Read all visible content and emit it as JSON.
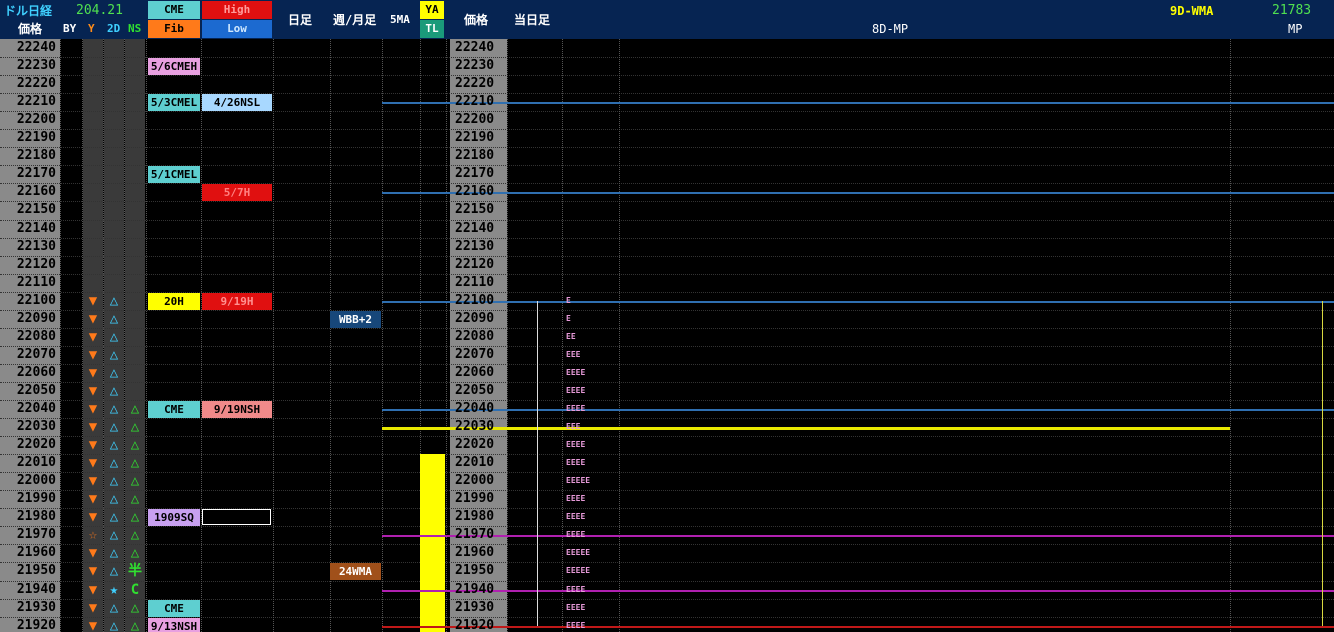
{
  "header": {
    "instrument": "ドル日経",
    "fx_value": "204.21",
    "price_label": "価格",
    "by": "BY",
    "y": "Y",
    "two_d": "2D",
    "ns": "NS",
    "cme": "CME",
    "fib": "Fib",
    "high": "High",
    "low": "Low",
    "daily": "日足",
    "weekly_monthly": "週/月足",
    "five_ma": "5MA",
    "ya": "YA",
    "tl": "TL",
    "price_label2": "価格",
    "today": "当日足",
    "wma_label": "9D-WMA",
    "wma_value": "21783",
    "mp8d": "8D-MP",
    "mp": "MP"
  },
  "prices": [
    "22240",
    "22230",
    "22220",
    "22210",
    "22200",
    "22190",
    "22180",
    "22170",
    "22160",
    "22150",
    "22140",
    "22130",
    "22120",
    "22110",
    "22100",
    "22090",
    "22080",
    "22070",
    "22060",
    "22050",
    "22040",
    "22030",
    "22020",
    "22010",
    "22000",
    "21990",
    "21980",
    "21970",
    "21960",
    "21950",
    "21940",
    "21930",
    "21920"
  ],
  "by_symbols": [
    "",
    "",
    "",
    "",
    "",
    "",
    "",
    "",
    "",
    "",
    "",
    "",
    "",
    "",
    "▼",
    "▼",
    "▼",
    "▼",
    "▼",
    "▼",
    "▼",
    "▼",
    "▼",
    "▼",
    "▼",
    "▼",
    "▼",
    "☆",
    "▼",
    "▼",
    "▼",
    "▼",
    "▼"
  ],
  "twod_symbols": [
    "",
    "",
    "",
    "",
    "",
    "",
    "",
    "",
    "",
    "",
    "",
    "",
    "",
    "",
    "△",
    "△",
    "△",
    "△",
    "△",
    "△",
    "△",
    "△",
    "△",
    "△",
    "△",
    "△",
    "△",
    "△",
    "△",
    "△",
    "★",
    "△",
    "△"
  ],
  "ns_symbols": [
    "",
    "",
    "",
    "",
    "",
    "",
    "",
    "",
    "",
    "",
    "",
    "",
    "",
    "",
    "",
    "",
    "",
    "",
    "",
    "",
    "△",
    "△",
    "△",
    "△",
    "△",
    "△",
    "△",
    "△",
    "△",
    "半",
    "C",
    "△",
    "△"
  ],
  "levels": [
    {
      "row": 1,
      "col": "cme",
      "text": "5/6CMEH",
      "bg": "#e8a0e0",
      "fg": "#000000"
    },
    {
      "row": 3,
      "col": "cme",
      "text": "5/3CMEL",
      "bg": "#5ecfd0",
      "fg": "#000000"
    },
    {
      "row": 3,
      "col": "hl",
      "text": "4/26NSL",
      "bg": "#a8d8ff",
      "fg": "#000000"
    },
    {
      "row": 7,
      "col": "cme",
      "text": "5/1CMEL",
      "bg": "#5ecfd0",
      "fg": "#000000"
    },
    {
      "row": 8,
      "col": "hl",
      "text": "5/7H",
      "bg": "#e01010",
      "fg": "#ff8080"
    },
    {
      "row": 14,
      "col": "cme",
      "text": "20H",
      "bg": "#ffff00",
      "fg": "#000000"
    },
    {
      "row": 14,
      "col": "hl",
      "text": "9/19H",
      "bg": "#e01010",
      "fg": "#ff9090"
    },
    {
      "row": 20,
      "col": "cme",
      "text": "CME",
      "bg": "#5ecfd0",
      "fg": "#000000"
    },
    {
      "row": 20,
      "col": "hl",
      "text": "9/19NSH",
      "bg": "#f08a8a",
      "fg": "#000000"
    },
    {
      "row": 26,
      "col": "cme",
      "text": "1909SQ",
      "bg": "#c8a0f0",
      "fg": "#000000"
    },
    {
      "row": 31,
      "col": "cme",
      "text": "CME",
      "bg": "#5ecfd0",
      "fg": "#000000"
    },
    {
      "row": 32,
      "col": "cme",
      "text": "9/13NSH",
      "bg": "#e8a0e0",
      "fg": "#000000"
    }
  ],
  "weekly_labels": [
    {
      "row": 15,
      "text": "WBB+2",
      "bg": "#17477a",
      "fg": "#ffffff"
    },
    {
      "row": 29,
      "text": "24WMA",
      "bg": "#a0501a",
      "fg": "#ffffff"
    }
  ],
  "tpo": [
    "",
    "",
    "",
    "",
    "",
    "",
    "",
    "",
    "",
    "",
    "",
    "",
    "",
    "",
    "E",
    "E",
    "EE",
    "EEE",
    "EEEE",
    "EEEE",
    "EEEE",
    "EEE",
    "EEEE",
    "EEEE",
    "EEEEE",
    "EEEE",
    "EEEE",
    "EEEE",
    "EEEEE",
    "EEEEE",
    "EEEE",
    "EEEE",
    "EEEE"
  ],
  "colors": {
    "header_bg": "#062452",
    "ref_blue": "#2f6fb0",
    "ref_yellow": "#e8e800",
    "ref_purple": "#b020b0",
    "ref_red": "#c01818",
    "ya_bar": "#ffff00"
  }
}
